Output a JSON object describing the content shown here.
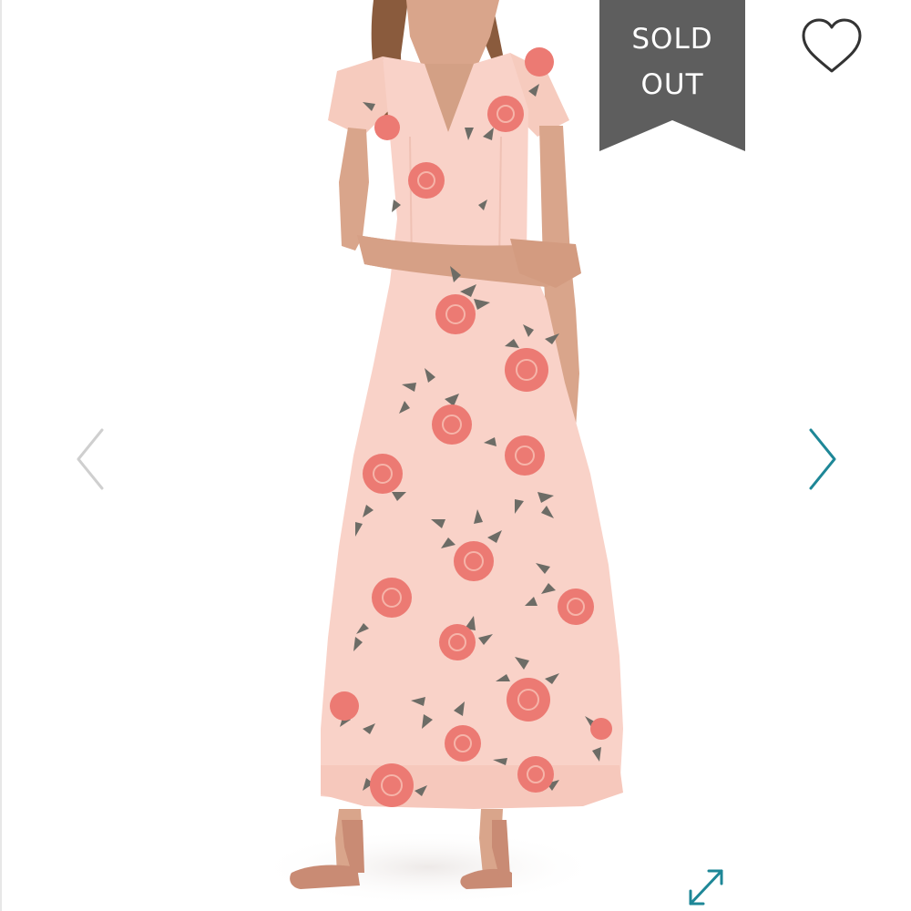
{
  "product": {
    "image_description_icon": "product-photo",
    "badge": {
      "text": "SOLD\nOUT",
      "background": "#5e5e5e",
      "text_color": "#ffffff"
    },
    "favorite_icon": "heart-outline-icon",
    "prev_icon": "chevron-left-icon",
    "next_icon": "chevron-right-icon",
    "expand_icon": "expand-arrows-icon"
  },
  "colors": {
    "dress": "#f9d2c8",
    "flower": "#ec7a73",
    "leaf": "#6d6c66",
    "skin": "#d9a58b",
    "hair": "#8a5b3d",
    "nav_prev": "#cfcfcf",
    "nav_next": "#1e8797",
    "expand": "#1e8797",
    "heart": "#333333"
  }
}
